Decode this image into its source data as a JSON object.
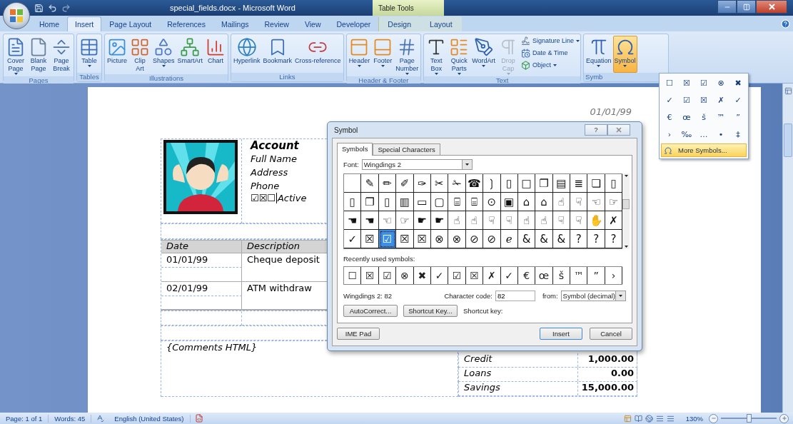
{
  "window": {
    "title": "special_fields.docx - Microsoft Word",
    "context_group": "Table Tools"
  },
  "tabs": [
    {
      "label": "Home",
      "selected": false,
      "contextual": false
    },
    {
      "label": "Insert",
      "selected": true,
      "contextual": false
    },
    {
      "label": "Page Layout",
      "selected": false,
      "contextual": false
    },
    {
      "label": "References",
      "selected": false,
      "contextual": false
    },
    {
      "label": "Mailings",
      "selected": false,
      "contextual": false
    },
    {
      "label": "Review",
      "selected": false,
      "contextual": false
    },
    {
      "label": "View",
      "selected": false,
      "contextual": false
    },
    {
      "label": "Developer",
      "selected": false,
      "contextual": false
    },
    {
      "label": "Design",
      "selected": false,
      "contextual": true
    },
    {
      "label": "Layout",
      "selected": false,
      "contextual": true
    }
  ],
  "ribbon": {
    "groups": [
      {
        "label": "Pages",
        "buttons": [
          {
            "kind": "large",
            "lines": [
              "Cover",
              "Page"
            ],
            "dropdown": true,
            "disabled": false,
            "pressed": false
          },
          {
            "kind": "large",
            "lines": [
              "Blank",
              "Page"
            ],
            "dropdown": false,
            "disabled": false,
            "pressed": false
          },
          {
            "kind": "large",
            "lines": [
              "Page",
              "Break"
            ],
            "dropdown": false,
            "disabled": false,
            "pressed": false
          }
        ]
      },
      {
        "label": "Tables",
        "buttons": [
          {
            "kind": "large",
            "lines": [
              "Table"
            ],
            "dropdown": true,
            "disabled": false,
            "pressed": false
          }
        ]
      },
      {
        "label": "Illustrations",
        "buttons": [
          {
            "kind": "large",
            "lines": [
              "Picture"
            ],
            "dropdown": false,
            "disabled": false,
            "pressed": false
          },
          {
            "kind": "large",
            "lines": [
              "Clip",
              "Art"
            ],
            "dropdown": false,
            "disabled": false,
            "pressed": false
          },
          {
            "kind": "large",
            "lines": [
              "Shapes"
            ],
            "dropdown": true,
            "disabled": false,
            "pressed": false
          },
          {
            "kind": "large",
            "lines": [
              "SmartArt"
            ],
            "dropdown": false,
            "disabled": false,
            "pressed": false
          },
          {
            "kind": "large",
            "lines": [
              "Chart"
            ],
            "dropdown": false,
            "disabled": false,
            "pressed": false
          }
        ]
      },
      {
        "label": "Links",
        "buttons": [
          {
            "kind": "large",
            "lines": [
              "Hyperlink"
            ],
            "dropdown": false,
            "disabled": false,
            "pressed": false
          },
          {
            "kind": "large",
            "lines": [
              "Bookmark"
            ],
            "dropdown": false,
            "disabled": false,
            "pressed": false
          },
          {
            "kind": "large",
            "lines": [
              "Cross-reference"
            ],
            "dropdown": false,
            "disabled": false,
            "pressed": false
          }
        ]
      },
      {
        "label": "Header & Footer",
        "buttons": [
          {
            "kind": "large",
            "lines": [
              "Header"
            ],
            "dropdown": true,
            "disabled": false,
            "pressed": false
          },
          {
            "kind": "large",
            "lines": [
              "Footer"
            ],
            "dropdown": true,
            "disabled": false,
            "pressed": false
          },
          {
            "kind": "large",
            "lines": [
              "Page",
              "Number"
            ],
            "dropdown": true,
            "disabled": false,
            "pressed": false
          }
        ]
      },
      {
        "label": "Text",
        "buttons": [
          {
            "kind": "large",
            "lines": [
              "Text",
              "Box"
            ],
            "dropdown": true,
            "disabled": false,
            "pressed": false
          },
          {
            "kind": "large",
            "lines": [
              "Quick",
              "Parts"
            ],
            "dropdown": true,
            "disabled": false,
            "pressed": false
          },
          {
            "kind": "large",
            "lines": [
              "WordArt"
            ],
            "dropdown": true,
            "disabled": false,
            "pressed": false
          },
          {
            "kind": "large",
            "lines": [
              "Drop",
              "Cap"
            ],
            "dropdown": true,
            "disabled": true,
            "pressed": false
          },
          {
            "kind": "small",
            "lines": [
              "Signature Line"
            ],
            "dropdown": true,
            "disabled": false,
            "pressed": false
          },
          {
            "kind": "small",
            "lines": [
              "Date & Time"
            ],
            "dropdown": false,
            "disabled": false,
            "pressed": false
          },
          {
            "kind": "small",
            "lines": [
              "Object"
            ],
            "dropdown": true,
            "disabled": false,
            "pressed": false
          }
        ]
      },
      {
        "label": "Symb",
        "buttons": [
          {
            "kind": "large",
            "lines": [
              "Equation"
            ],
            "dropdown": true,
            "disabled": false,
            "pressed": false
          },
          {
            "kind": "large",
            "lines": [
              "Symbol"
            ],
            "dropdown": true,
            "disabled": false,
            "pressed": true
          }
        ]
      }
    ]
  },
  "symbol_menu": {
    "symbols": [
      "☐",
      "☒",
      "☑",
      "⊗",
      "✖",
      "✓",
      "☑",
      "☒",
      "✗",
      "✓",
      "€",
      "œ",
      "š",
      "™",
      "”",
      "›",
      "‰",
      "…",
      "•",
      "‡"
    ],
    "more": {
      "label": "More Symbols...",
      "highlighted": true
    }
  },
  "document": {
    "date": "01/01/99",
    "account": {
      "title": "Account",
      "fields": [
        "Full Name",
        "Address",
        "Phone"
      ],
      "checks": "☑☒☐",
      "active_label": "Active"
    },
    "transactions": {
      "columns": [
        "Date",
        "Description"
      ],
      "rows": [
        {
          "date": "01/01/99",
          "description": "Cheque deposit"
        },
        {
          "date": "02/01/99",
          "description": "ATM withdraw"
        }
      ]
    },
    "comments": "{Comments HTML}",
    "summary": [
      {
        "label": "Credit",
        "value": "1,000.00"
      },
      {
        "label": "Loans",
        "value": "0.00"
      },
      {
        "label": "Savings",
        "value": "15,000.00"
      }
    ]
  },
  "dialog": {
    "title": "Symbol",
    "help": "?",
    "tabs": [
      {
        "label": "Symbols",
        "selected": true
      },
      {
        "label": "Special Characters",
        "selected": false
      }
    ],
    "font_label": "Font:",
    "font": "Wingdings 2",
    "grid": [
      {
        "selected": false
      },
      {
        "glyph": "✎",
        "selected": false
      },
      {
        "glyph": "✏",
        "selected": false
      },
      {
        "glyph": "✐",
        "selected": false
      },
      {
        "glyph": "✑",
        "selected": false
      },
      {
        "glyph": "✂",
        "selected": false
      },
      {
        "glyph": "✁",
        "selected": false
      },
      {
        "glyph": "☎",
        "selected": false
      },
      {
        "glyph": "❳",
        "selected": false
      },
      {
        "glyph": "▯",
        "selected": false
      },
      {
        "glyph": "□",
        "selected": false
      },
      {
        "glyph": "❐",
        "selected": false
      },
      {
        "glyph": "▤",
        "selected": false
      },
      {
        "glyph": "≣",
        "selected": false
      },
      {
        "glyph": "❏",
        "selected": false
      },
      {
        "glyph": "▯",
        "selected": false
      },
      {
        "glyph": "▯",
        "selected": false
      },
      {
        "glyph": "❐",
        "selected": false
      },
      {
        "glyph": "▯",
        "selected": false
      },
      {
        "glyph": "▥",
        "selected": false
      },
      {
        "glyph": "▭",
        "selected": false
      },
      {
        "glyph": "▢",
        "selected": false
      },
      {
        "glyph": "⌸",
        "selected": false
      },
      {
        "glyph": "⌸",
        "selected": false
      },
      {
        "glyph": "⊙",
        "selected": false
      },
      {
        "glyph": "▣",
        "selected": false
      },
      {
        "glyph": "⌂",
        "selected": false
      },
      {
        "glyph": "⌂",
        "selected": false
      },
      {
        "glyph": "☝",
        "selected": false
      },
      {
        "glyph": "☟",
        "selected": false
      },
      {
        "glyph": "☜",
        "selected": false
      },
      {
        "glyph": "☞",
        "selected": false
      },
      {
        "glyph": "☚",
        "selected": false
      },
      {
        "glyph": "☚",
        "selected": false
      },
      {
        "glyph": "☜",
        "selected": false
      },
      {
        "glyph": "☞",
        "selected": false
      },
      {
        "glyph": "☛",
        "selected": false
      },
      {
        "glyph": "☛",
        "selected": false
      },
      {
        "glyph": "☝",
        "selected": false
      },
      {
        "glyph": "☝",
        "selected": false
      },
      {
        "glyph": "☟",
        "selected": false
      },
      {
        "glyph": "☟",
        "selected": false
      },
      {
        "glyph": "☝",
        "selected": false
      },
      {
        "glyph": "☝",
        "selected": false
      },
      {
        "glyph": "☟",
        "selected": false
      },
      {
        "glyph": "☟",
        "selected": false
      },
      {
        "glyph": "✋",
        "selected": false
      },
      {
        "glyph": "✗",
        "selected": false
      },
      {
        "glyph": "✓",
        "selected": false
      },
      {
        "glyph": "☒",
        "selected": false
      },
      {
        "glyph": "☑",
        "selected": true
      },
      {
        "glyph": "☒",
        "selected": false
      },
      {
        "glyph": "☒",
        "selected": false
      },
      {
        "glyph": "⊗",
        "selected": false
      },
      {
        "glyph": "⊗",
        "selected": false
      },
      {
        "glyph": "⊘",
        "selected": false
      },
      {
        "glyph": "⊘",
        "selected": false
      },
      {
        "glyph": "ℯ",
        "selected": false
      },
      {
        "glyph": "&",
        "selected": false
      },
      {
        "glyph": "&",
        "selected": false
      },
      {
        "glyph": "&",
        "selected": false
      },
      {
        "glyph": "?",
        "selected": false
      },
      {
        "glyph": "?",
        "selected": false
      },
      {
        "glyph": "?",
        "selected": false
      }
    ],
    "recent_label": "Recently used symbols:",
    "recent": [
      "☐",
      "☒",
      "☑",
      "⊗",
      "✖",
      "✓",
      "☑",
      "☒",
      "✗",
      "✓",
      "€",
      "œ",
      "š",
      "™",
      "”",
      "›"
    ],
    "char_name": "Wingdings 2: 82",
    "code_label": "Character code:",
    "code": "82",
    "from_label": "from:",
    "from": "Symbol (decimal)",
    "autocorrect": "AutoCorrect...",
    "shortcut_button": "Shortcut Key...",
    "shortcut_label": "Shortcut key:",
    "ime": "IME Pad",
    "insert": "Insert",
    "cancel": "Cancel"
  },
  "status_bar": {
    "page": "Page: 1 of 1",
    "words": "Words: 45",
    "language": "English (United States)",
    "zoom": "130%",
    "zoom_slider": {
      "level": 0.5
    }
  }
}
